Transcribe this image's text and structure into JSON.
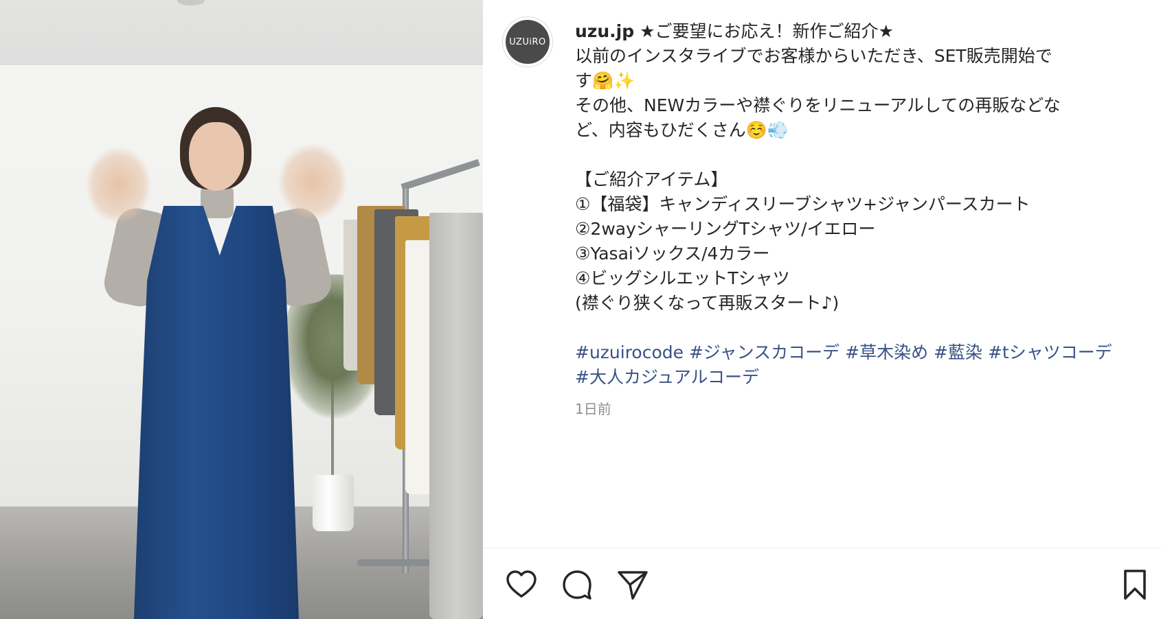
{
  "post": {
    "username": "uzu.jp",
    "avatar_text": "UZUiRO",
    "caption_lines": [
      "★ご要望にお応え！新作ご紹介★",
      "以前のインスタライブでお客様からいただき、SET販売開始で",
      "す🤗✨",
      "その他、NEWカラーや襟ぐりをリニューアルしての再販などな",
      "ど、内容もひだくさん☺️💨",
      "",
      "【ご紹介アイテム】",
      "①【福袋】キャンディスリーブシャツ+ジャンパースカート",
      "②2wayシャーリングTシャツ/イエロー",
      "③Yasaiソックス/4カラー",
      "④ビッグシルエットTシャツ",
      "(襟ぐり狭くなって再販スタート♪)",
      ""
    ],
    "hashtags": [
      "#uzuirocode",
      "#ジャンスカコーデ",
      "#草木染め",
      "#藍染",
      "#tシャツコーデ",
      "#大人カジュアルコーデ"
    ],
    "timestamp": "1日前"
  },
  "actions": {
    "like_icon": "heart-icon",
    "comment_icon": "comment-icon",
    "share_icon": "send-icon",
    "save_icon": "bookmark-icon"
  },
  "colors": {
    "text": "#262626",
    "hashtag": "#385185",
    "muted": "#8e8e8e",
    "divider": "#efefef"
  }
}
